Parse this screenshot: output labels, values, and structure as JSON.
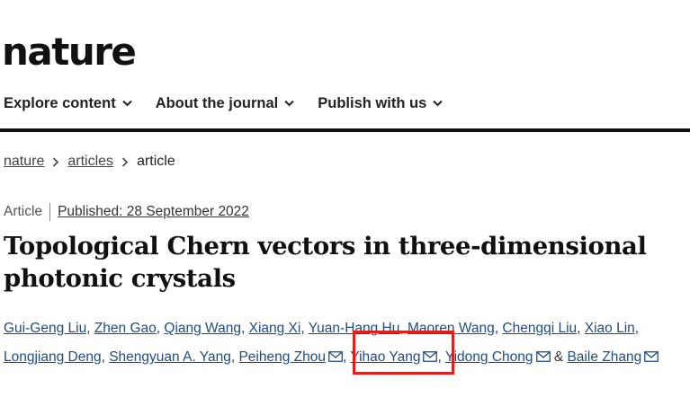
{
  "site": {
    "logo": "nature"
  },
  "nav": {
    "items": [
      {
        "label": "Explore content"
      },
      {
        "label": "About the journal"
      },
      {
        "label": "Publish with us"
      }
    ]
  },
  "breadcrumb": {
    "items": [
      "nature",
      "articles",
      "article"
    ]
  },
  "article": {
    "type": "Article",
    "published": "Published: 28 September 2022",
    "title": "Topological Chern vectors in three-dimensional photonic crystals"
  },
  "authors": {
    "line1": [
      "Gui-Geng Liu",
      "Zhen Gao",
      "Qiang Wang",
      "Xiang Xi",
      "Yuan-Hang Hu",
      "Maoren Wang",
      "Chengqi Liu",
      "Xiao Lin"
    ],
    "line2": [
      "Longjiang Deng",
      "Shengyuan A. Yang",
      "Peiheng Zhou",
      "Yihao Yang",
      "Yidong Chong",
      "Baile Zhang"
    ],
    "separator": ",",
    "ampersand": "&"
  },
  "colors": {
    "link": "#1f4d82",
    "highlight_box": "#e0201b",
    "text": "#222222"
  },
  "icons": {
    "chevron": "chevron-down-icon",
    "breadcrumb_sep": "chevron-right-icon",
    "mail": "mail-icon"
  }
}
